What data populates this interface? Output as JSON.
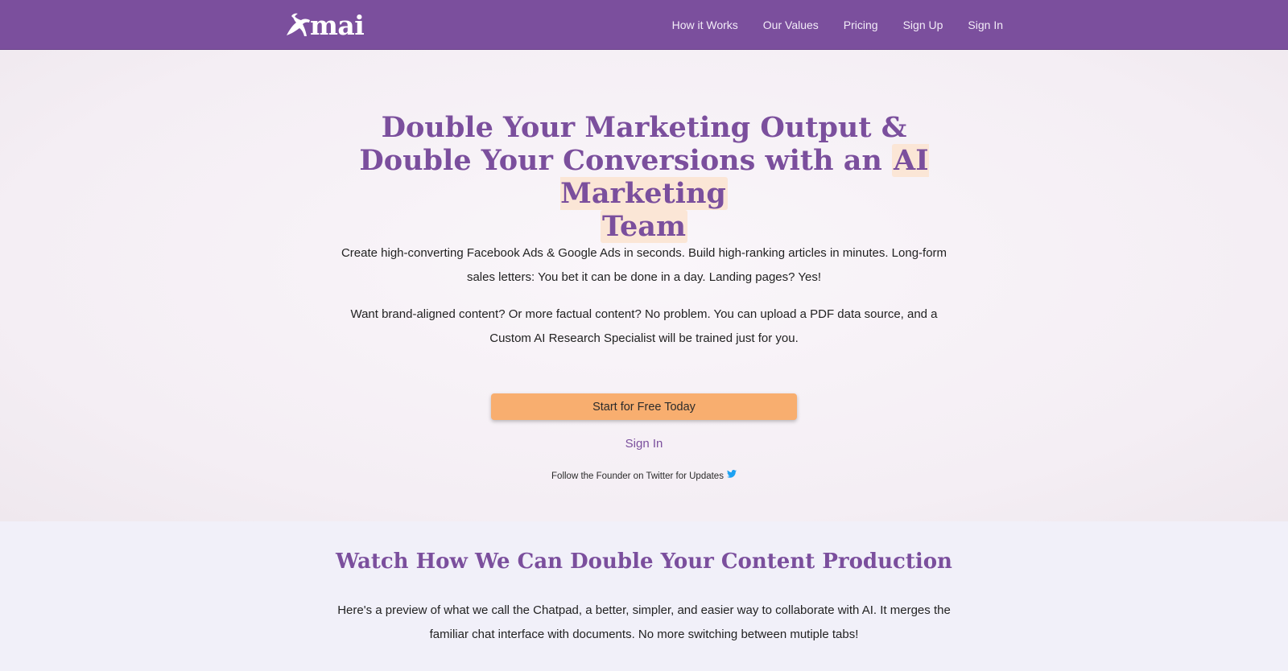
{
  "nav": {
    "logo_text": "mai",
    "links": [
      "How it Works",
      "Our Values",
      "Pricing",
      "Sign Up",
      "Sign In"
    ]
  },
  "hero": {
    "title_plain": "Double Your Marketing Output & Double Your Conversions with an ",
    "title_highlight_1": "AI Marketing",
    "title_highlight_2": "Team",
    "paragraph_1": "Create high-converting Facebook Ads & Google Ads in seconds. Build high-ranking articles in minutes. Long-form sales letters: You bet it can be done in a day. Landing pages? Yes!",
    "paragraph_2": "Want brand-aligned content? Or more factual content? No problem. You can upload a PDF data source, and a Custom AI Research Specialist will be trained just for you.",
    "cta_label": "Start for Free Today",
    "signin_label": "Sign In",
    "twitter_text": "Follow the Founder on Twitter for Updates"
  },
  "section2": {
    "title": "Watch How We Can Double Your Content Production",
    "paragraph": "Here's a preview of what we call the Chatpad, a better, simpler, and easier way to collaborate with AI. It merges the familiar chat interface with documents. No more switching between mutiple tabs!"
  },
  "colors": {
    "brand_purple": "#7b4f9d",
    "cta_orange": "#f8ae6f",
    "highlight": "#fbe6d6",
    "twitter_blue": "#1da1f2"
  },
  "icons": [
    "pegasus-logo-icon",
    "twitter-icon"
  ]
}
